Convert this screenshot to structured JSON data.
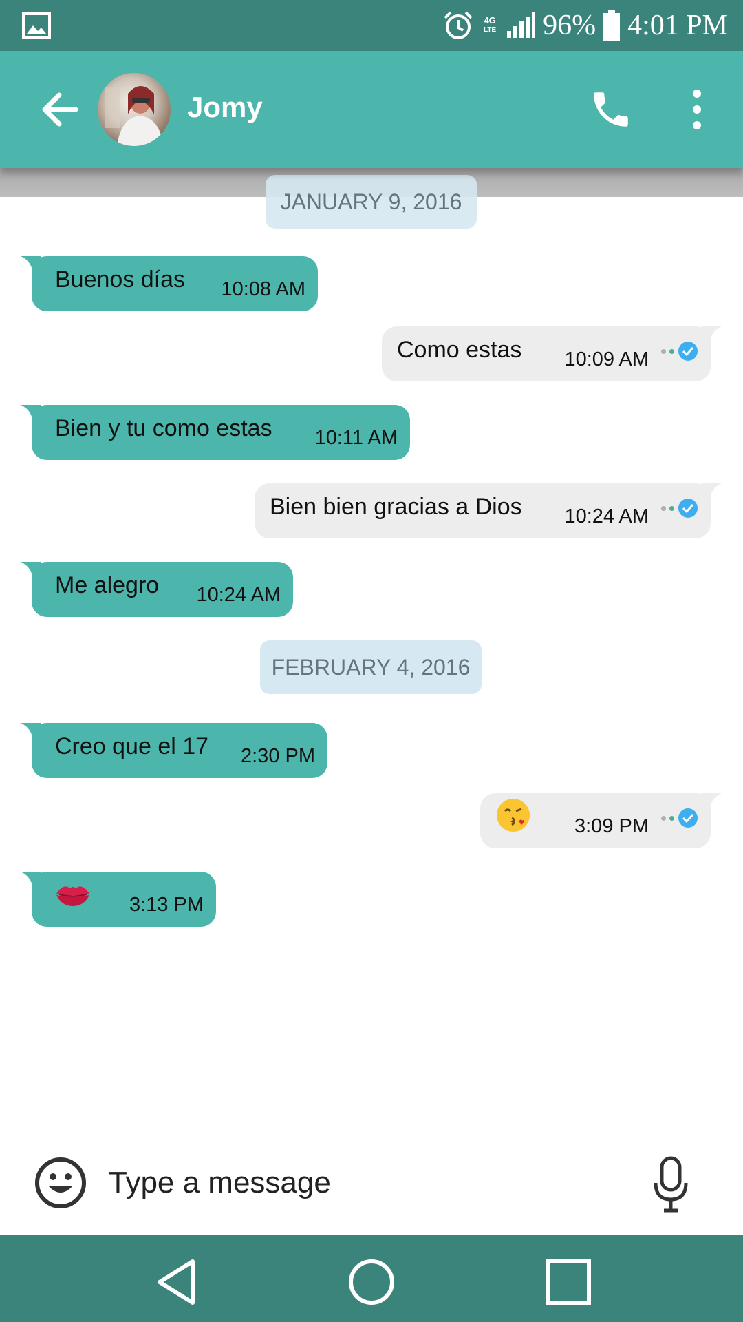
{
  "status_bar": {
    "gallery_icon": "image-icon",
    "alarm_icon": "alarm-icon",
    "network_label": "4G",
    "network_sub": "LTE",
    "battery": "96%",
    "time": "4:01 PM"
  },
  "header": {
    "contact_name": "Jomy",
    "back_icon": "arrow-back-icon",
    "call_icon": "phone-icon",
    "menu_icon": "more-vert-icon"
  },
  "chat": {
    "date_chips": [
      "JANUARY 9, 2016",
      "FEBRUARY 4, 2016"
    ],
    "messages": [
      {
        "direction": "in",
        "text": "Buenos días",
        "time": "10:08 AM"
      },
      {
        "direction": "out",
        "text": "Como estas",
        "time": "10:09 AM",
        "read": true
      },
      {
        "direction": "in",
        "text": "Bien y tu como estas",
        "time": "10:11 AM"
      },
      {
        "direction": "out",
        "text": "Bien bien gracias a Dios",
        "time": "10:24 AM",
        "read": true
      },
      {
        "direction": "in",
        "text": "Me alegro",
        "time": "10:24 AM"
      },
      {
        "direction": "in",
        "text": "Creo que el 17",
        "time": "2:30 PM"
      },
      {
        "direction": "out",
        "emoji": "kissing-face-emoji",
        "time": "3:09 PM",
        "read": true
      },
      {
        "direction": "in",
        "emoji": "kiss-mark-emoji",
        "time": "3:13 PM"
      }
    ]
  },
  "composer": {
    "placeholder": "Type a message",
    "emoji_icon": "smiley-icon",
    "mic_icon": "microphone-icon"
  },
  "nav_bar": {
    "back_icon": "nav-back-icon",
    "home_icon": "nav-home-icon",
    "recents_icon": "nav-recents-icon"
  },
  "colors": {
    "status_bar": "#3b847c",
    "app_bar": "#4db6ac",
    "incoming_bubble": "#4db6ac",
    "outgoing_bubble": "#ededed",
    "date_chip": "#d6e8f1",
    "read_tick": "#3daef0"
  }
}
